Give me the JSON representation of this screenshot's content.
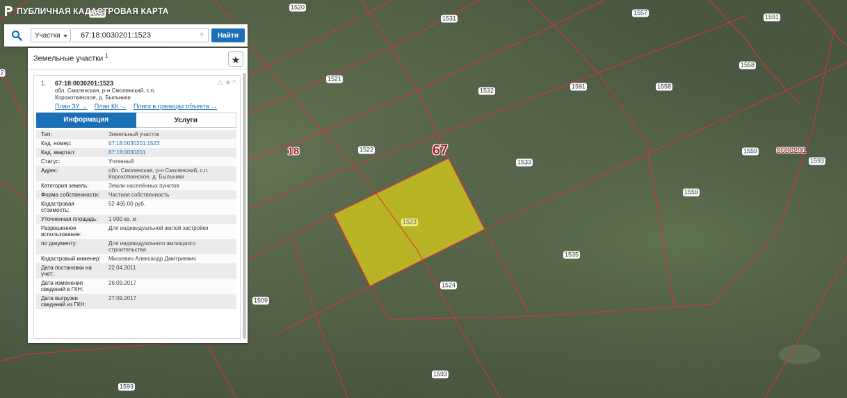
{
  "app": {
    "title": "ПУБЛИЧНАЯ КАДАСТРОВАЯ КАРТА"
  },
  "search": {
    "type_label": "Участки",
    "value": "67:18:0030201:1523",
    "clear_icon": "×",
    "button_label": "Найти"
  },
  "panel": {
    "header": "Земельные участки",
    "count": "1",
    "star_icon": "★",
    "result": {
      "number": "1.",
      "cadastral_number": "67:18:0030201:1523",
      "address": "обл. Смоленская, р-н Смоленский, с.п. Корохоткинское, д. Быльники",
      "icons": [
        "⚠",
        "★",
        "^"
      ],
      "links": [
        {
          "label": "План ЗУ →"
        },
        {
          "label": "План КК →"
        },
        {
          "label": "Поиск в границах объекта →"
        }
      ],
      "tabs": [
        {
          "label": "Информация",
          "active": true
        },
        {
          "label": "Услуги",
          "active": false
        }
      ],
      "info_rows": [
        {
          "key": "Тип:",
          "value": "Земельный участок"
        },
        {
          "key": "Кад. номер:",
          "value": "67:18:0030201:1523",
          "link": true
        },
        {
          "key": "Кад. квартал:",
          "value": "67:18:0030201",
          "link": true
        },
        {
          "key": "Статус:",
          "value": "Учтенный"
        },
        {
          "key": "Адрес:",
          "value": "обл. Смоленская, р-н Смоленский, с.п. Корохоткинское, д. Быльники"
        },
        {
          "key": "Категория земель:",
          "value": "Земли населённых пунктов"
        },
        {
          "key": "Форма собственности:",
          "value": "Частная собственность"
        },
        {
          "key": "Кадастровая стоимость:",
          "value": "52 460,00 руб."
        },
        {
          "key": "Уточненная площадь:",
          "value": "1 000 кв. м"
        },
        {
          "key": "Разрешенное использование:",
          "value": "Для индивидуальной жилой застройки"
        },
        {
          "key": "по документу:",
          "value": "Для индивидуального жилищного строительства"
        },
        {
          "key": "Кадастровый инженер:",
          "value": "Мискевич Александр Дмитриевич"
        },
        {
          "key": "Дата постановки на учет:",
          "value": "22.04.2011"
        },
        {
          "key": "Дата изменения сведений в ГКН:",
          "value": "26.09.2017"
        },
        {
          "key": "Дата выгрузки сведений из ГКН:",
          "value": "27.09.2017"
        }
      ]
    }
  },
  "map": {
    "parcel_labels": [
      "1505",
      "1520",
      "1531",
      "1557",
      "1591",
      "1558",
      "1521",
      "1532",
      "1591",
      "1558",
      "1522",
      "1533",
      "1559",
      "1593",
      "1523",
      "1559",
      "1535",
      "1524",
      "1509",
      "1593",
      "1593",
      "2"
    ],
    "quarter_labels": [
      "18",
      "67",
      "0030201"
    ],
    "selected_parcel": "1523",
    "colors": {
      "boundary": "#e0303a",
      "selected_fill": "#c8c21e",
      "satellite": "#4d5d3f"
    }
  }
}
